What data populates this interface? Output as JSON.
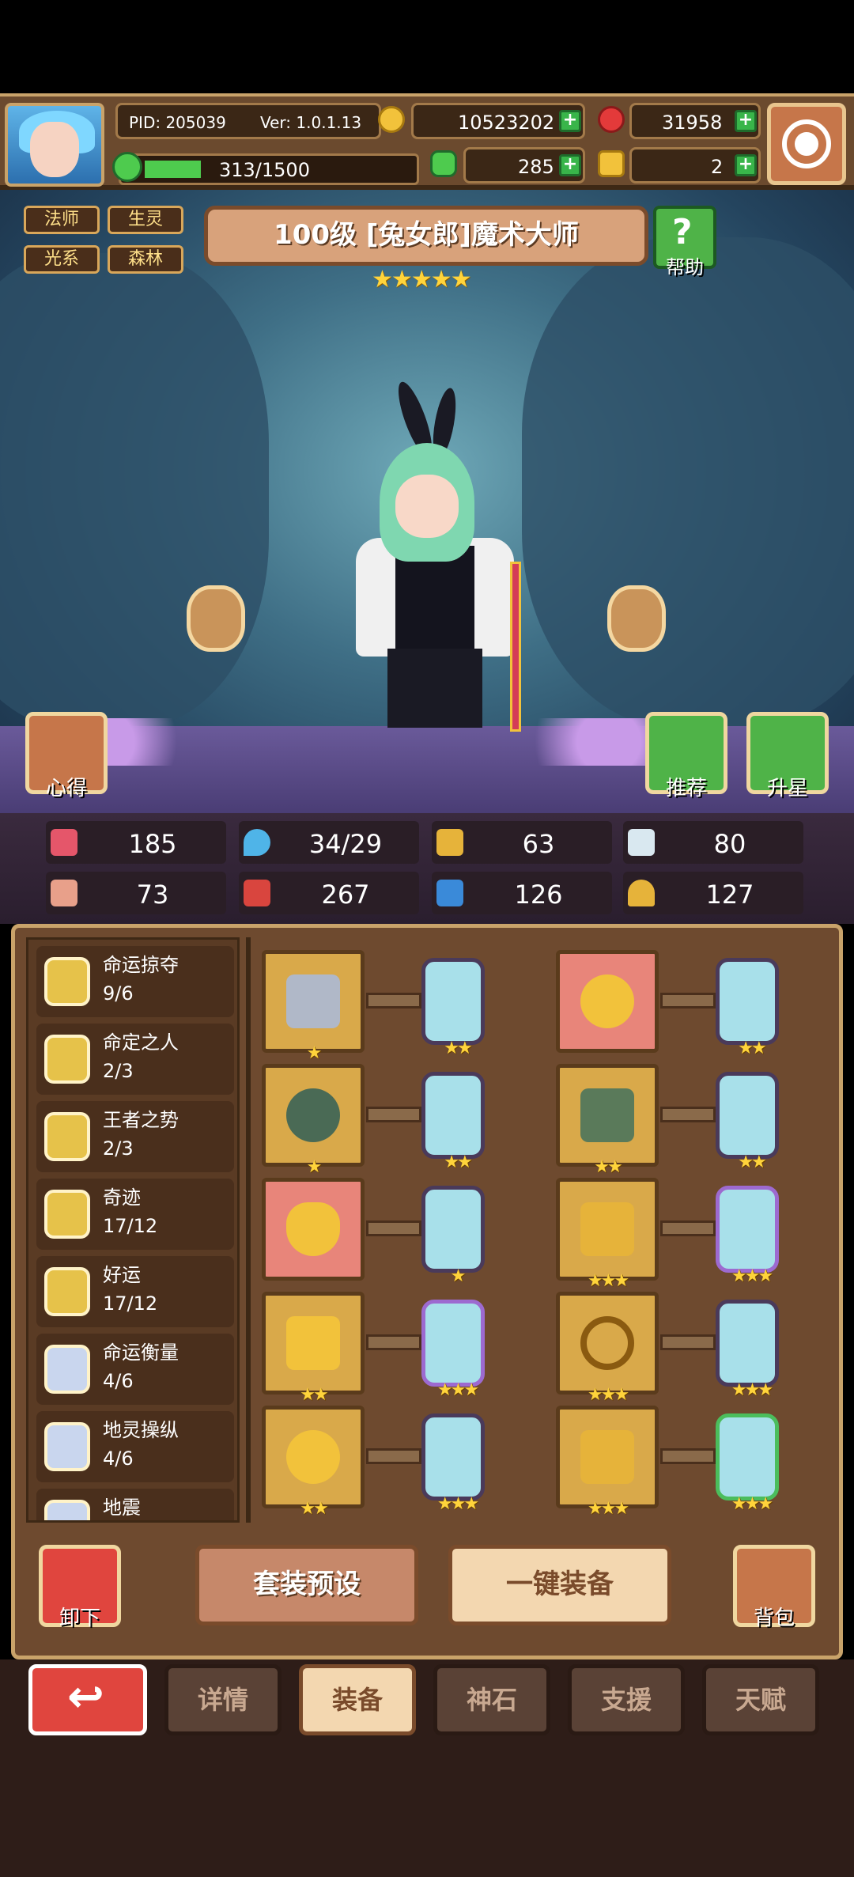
{
  "topbar": {
    "pid": "PID: 205039",
    "ver": "Ver: 1.0.1.13",
    "gold": "10523202",
    "gems": "31958",
    "clover": "285",
    "keys": "2",
    "xp": "313/1500",
    "xp_fraction": 0.2087
  },
  "hero": {
    "tags": [
      "法师",
      "生灵",
      "光系",
      "森林"
    ],
    "title": "100级 [兔女郎]魔术大师",
    "stars": "★★★★★",
    "help_label": "帮助",
    "left_btn_label": "心得",
    "recommend_label": "推荐",
    "upstar_label": "升星"
  },
  "stats": [
    {
      "icon": "heart-icon",
      "value": "185",
      "color": "#e5566a"
    },
    {
      "icon": "water-drop-icon",
      "value": "34/29",
      "color": "#4fb4e8"
    },
    {
      "icon": "shield-icon",
      "value": "63",
      "color": "#e6b33a"
    },
    {
      "icon": "wing-icon",
      "value": "80",
      "color": "#d9e8f0"
    },
    {
      "icon": "fist-icon",
      "value": "73",
      "color": "#e8a08a"
    },
    {
      "icon": "book-icon",
      "value": "267",
      "color": "#d9453e"
    },
    {
      "icon": "scroll-icon",
      "value": "126",
      "color": "#3a8ad9"
    },
    {
      "icon": "horseshoe-icon",
      "value": "127",
      "color": "#e6b33a"
    }
  ],
  "sets": [
    {
      "name": "命运掠夺",
      "count": "9/6",
      "color": "#e6c24a"
    },
    {
      "name": "命定之人",
      "count": "2/3",
      "color": "#e6c24a"
    },
    {
      "name": "王者之势",
      "count": "2/3",
      "color": "#e6c24a"
    },
    {
      "name": "奇迹",
      "count": "17/12",
      "color": "#e6c24a"
    },
    {
      "name": "好运",
      "count": "17/12",
      "color": "#e6c24a"
    },
    {
      "name": "命运衡量",
      "count": "4/6",
      "color": "#c9d6ee"
    },
    {
      "name": "地灵操纵",
      "count": "4/6",
      "color": "#c9d6ee"
    },
    {
      "name": "地震",
      "count": "",
      "color": "#c9d6ee"
    }
  ],
  "equip_stars": {
    "r1l": "★",
    "r1lg": "★★",
    "r1r": "",
    "r1rg": "★★",
    "r2l": "★",
    "r2lg": "★★",
    "r2r": "★★",
    "r2rg": "★★",
    "r3l": "",
    "r3lg": "★",
    "r3r": "★★★",
    "r3rg": "★★★",
    "r4l": "★★",
    "r4lg": "★★★",
    "r4r": "★★★",
    "r4rg": "★★★",
    "r5l": "★★",
    "r5lg": "★★★",
    "r5r": "★★★",
    "r5rg": "★★★"
  },
  "actions": {
    "unequip": "卸下",
    "preset": "套装预设",
    "auto_equip": "一键装备",
    "bag": "背包"
  },
  "tabs": [
    "详情",
    "装备",
    "神石",
    "支援",
    "天赋"
  ],
  "active_tab": "装备"
}
